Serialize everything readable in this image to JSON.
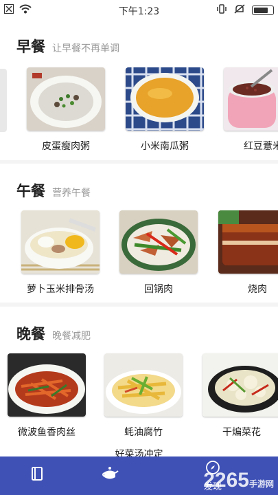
{
  "status_bar": {
    "time": "下午1:23"
  },
  "sections": [
    {
      "title": "早餐",
      "subtitle": "让早餐不再单调",
      "items": [
        {
          "name": "皮蛋瘦肉粥"
        },
        {
          "name": "小米南瓜粥"
        },
        {
          "name": "红豆薏米"
        }
      ]
    },
    {
      "title": "午餐",
      "subtitle": "营养午餐",
      "items": [
        {
          "name": "萝卜玉米排骨汤"
        },
        {
          "name": "回锅肉"
        },
        {
          "name": "烧肉"
        }
      ]
    },
    {
      "title": "晚餐",
      "subtitle": "晚餐减肥",
      "items": [
        {
          "name": "微波鱼香肉丝"
        },
        {
          "name": "蚝油腐竹"
        },
        {
          "name": "干煸菜花"
        }
      ]
    }
  ],
  "peek_text": "好菜汤冲定",
  "tabbar": {
    "tabs": [
      {
        "label": ""
      },
      {
        "label": ""
      },
      {
        "label": "发现"
      }
    ]
  },
  "watermark": {
    "text": "2265",
    "suffix": "手游网"
  },
  "colors": {
    "tabbar": "#3f51b5",
    "title": "#222222",
    "subtitle": "#999999"
  }
}
